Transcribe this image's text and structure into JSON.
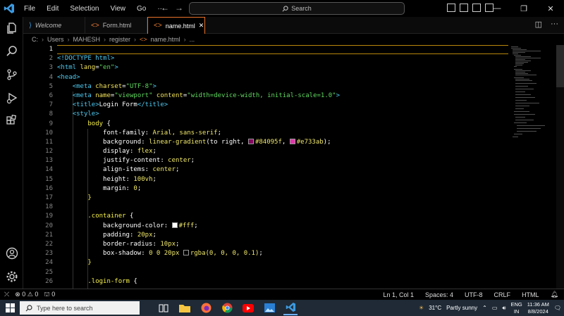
{
  "menu": [
    "File",
    "Edit",
    "Selection",
    "View",
    "Go",
    "···"
  ],
  "search": {
    "label": "Search"
  },
  "tabs": [
    {
      "label": "Welcome",
      "kind": "vscode"
    },
    {
      "label": "Form.html",
      "kind": "html"
    },
    {
      "label": "name.html",
      "kind": "html",
      "active": true
    }
  ],
  "breadcrumb": [
    "C:",
    "Users",
    "MAHESH",
    "register",
    "name.html",
    "..."
  ],
  "line_numbers": [
    "1",
    "2",
    "3",
    "4",
    "5",
    "6",
    "7",
    "8",
    "9",
    "10",
    "11",
    "12",
    "13",
    "14",
    "15",
    "16",
    "17",
    "18",
    "19",
    "20",
    "21",
    "22",
    "23",
    "24",
    "25",
    "26"
  ],
  "code": {
    "l2_doctype": "<!DOCTYPE html>",
    "l3_html_open": "<html",
    "l3_attr": "lang",
    "l3_val": "\"en\"",
    "l3_close": ">",
    "l4": "<head>",
    "l5_tag": "<meta",
    "l5_attr": "charset",
    "l5_val": "\"UTF-8\"",
    "l5_close": ">",
    "l6_tag": "<meta",
    "l6_attr1": "name",
    "l6_val1": "\"viewport\"",
    "l6_attr2": "content",
    "l6_val2": "\"width=device-width, initial-scale=1.0\"",
    "l6_close": ">",
    "l7_open": "<title>",
    "l7_text": "Login Form",
    "l7_close": "</title>",
    "l8": "<style>",
    "l9_sel": "body",
    "l9_brace": " {",
    "l10_prop": "font-family",
    "l10_val": "Arial, sans-serif",
    "l11_prop": "background",
    "l11_fn": "linear-gradient",
    "l11_arg": "(to right, ",
    "l11_c1": "#84095f",
    "l11_c2": "#e733ab",
    "l11_end": ");",
    "l12_prop": "display",
    "l12_val": "flex",
    "l13_prop": "justify-content",
    "l13_val": "center",
    "l14_prop": "align-items",
    "l14_val": "center",
    "l15_prop": "height",
    "l15_val": "100vh",
    "l16_prop": "margin",
    "l16_val": "0",
    "l17": "}",
    "l19_sel": ".container",
    "l19_brace": " {",
    "l20_prop": "background-color",
    "l20_val": "#fff",
    "l21_prop": "padding",
    "l21_val": "20px",
    "l22_prop": "border-radius",
    "l22_val": "10px",
    "l23_prop": "box-shadow",
    "l23_pre": "0 0 20px ",
    "l23_val": "rgba(0, 0, 0, 0.1)",
    "l24": "}",
    "l26_sel": ".login-form",
    "l26_brace": " {"
  },
  "colors": {
    "swatch_white": "#ffffff",
    "swatch_dark": "#000000",
    "swatch_1": "#84095f",
    "swatch_2": "#e733ab",
    "accent": "#e8722a"
  },
  "status": {
    "errors": "0",
    "warnings": "0",
    "ports": "0",
    "position": "Ln 1, Col 1",
    "spaces": "Spaces: 4",
    "encoding": "UTF-8",
    "eol": "CRLF",
    "language": "HTML"
  },
  "taskbar": {
    "search_placeholder": "Type here to search",
    "temperature": "31°C",
    "weather": "Partly sunny",
    "lang1": "ENG",
    "lang2": "IN",
    "time": "11:36 AM",
    "date": "8/8/2024"
  }
}
